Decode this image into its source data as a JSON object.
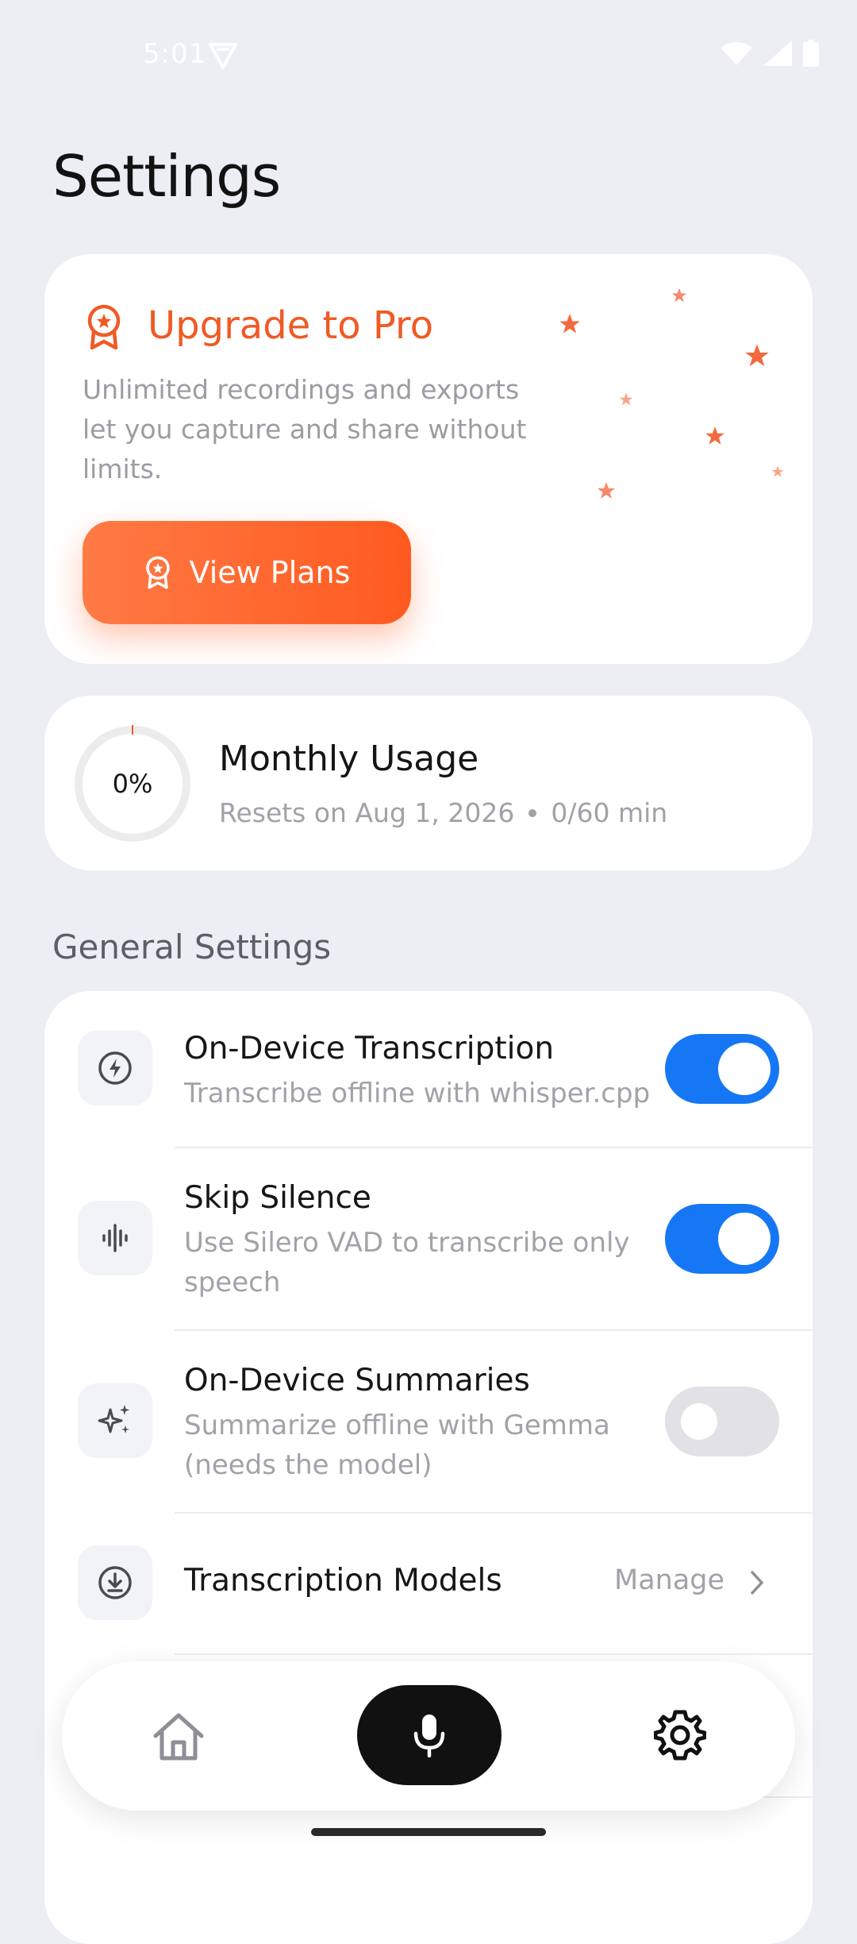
{
  "status_bar": {
    "time": "5:01"
  },
  "page": {
    "title": "Settings"
  },
  "pro_card": {
    "title": "Upgrade to Pro",
    "description": "Unlimited recordings and exports let you capture and share without limits.",
    "button_label": "View Plans",
    "accent_color": "#f05a24"
  },
  "usage": {
    "title": "Monthly Usage",
    "percent_label": "0%",
    "percent_value": 0,
    "resets": "Resets on Aug 1, 2026",
    "minutes": "0/60 min"
  },
  "general_settings": {
    "header": "General Settings",
    "items": [
      {
        "title": "On-Device Transcription",
        "description": "Transcribe offline with whisper.cpp",
        "icon": "bolt-icon",
        "enabled": true
      },
      {
        "title": "Skip Silence",
        "description": "Use Silero VAD to transcribe only speech",
        "icon": "waveform-icon",
        "enabled": true
      },
      {
        "title": "On-Device Summaries",
        "description": "Summarize offline with Gemma (needs the model)",
        "icon": "sparkles-icon",
        "enabled": false
      },
      {
        "title": "Transcription Models",
        "action": "Manage",
        "icon": "download-circle-icon"
      }
    ]
  },
  "bottom_nav": {
    "items": [
      "home-icon",
      "microphone-icon",
      "gear-icon"
    ],
    "active": "gear-icon"
  },
  "colors": {
    "toggle_on": "#1677f5",
    "toggle_off": "#e2e2e6",
    "background": "#eceef3"
  }
}
